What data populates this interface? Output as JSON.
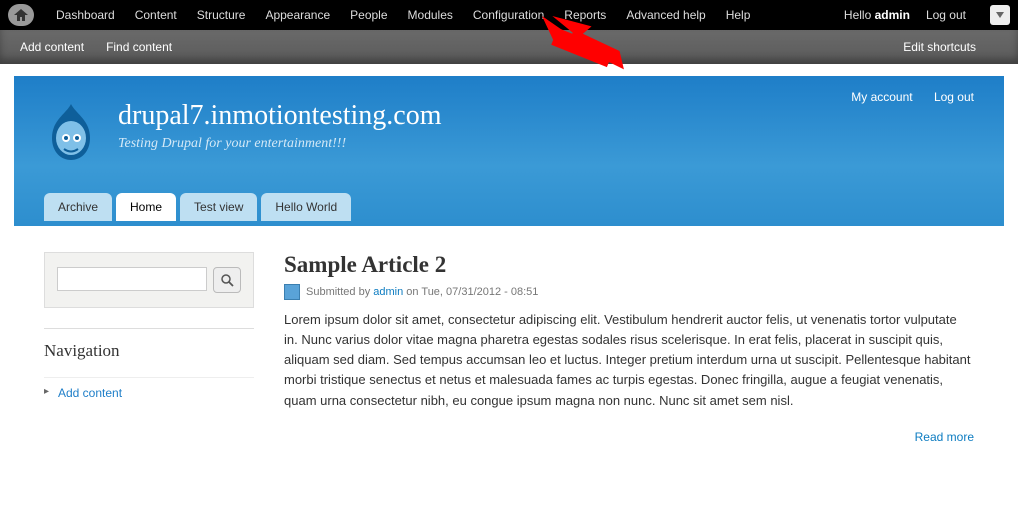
{
  "adminMenu": {
    "items": [
      "Dashboard",
      "Content",
      "Structure",
      "Appearance",
      "People",
      "Modules",
      "Configuration",
      "Reports",
      "Advanced help",
      "Help"
    ],
    "helloPrefix": "Hello ",
    "helloUser": "admin",
    "logout": "Log out"
  },
  "shortcuts": {
    "left": [
      "Add content",
      "Find content"
    ],
    "right": "Edit shortcuts"
  },
  "header": {
    "links": [
      "My account",
      "Log out"
    ],
    "siteName": "drupal7.inmotiontesting.com",
    "slogan": "Testing Drupal for your entertainment!!!"
  },
  "tabs": [
    {
      "label": "Archive",
      "active": false
    },
    {
      "label": "Home",
      "active": true
    },
    {
      "label": "Test view",
      "active": false
    },
    {
      "label": "Hello World",
      "active": false
    }
  ],
  "sidebar": {
    "navTitle": "Navigation",
    "navItems": [
      "Add content"
    ]
  },
  "article": {
    "title": "Sample Article 2",
    "submittedPrefix": "Submitted by ",
    "author": "admin",
    "submittedSuffix": " on Tue, 07/31/2012 - 08:51",
    "body": "Lorem ipsum dolor sit amet, consectetur adipiscing elit. Vestibulum hendrerit auctor felis, ut venenatis tortor vulputate in. Nunc varius dolor vitae magna pharetra egestas sodales risus scelerisque. In erat felis, placerat in suscipit quis, aliquam sed diam. Sed tempus accumsan leo et luctus. Integer pretium interdum urna ut suscipit. Pellentesque habitant morbi tristique senectus et netus et malesuada fames ac turpis egestas. Donec fringilla, augue a feugiat venenatis, quam urna consectetur nibh, eu congue ipsum magna non nunc. Nunc sit amet sem nisl.",
    "readMore": "Read more"
  }
}
